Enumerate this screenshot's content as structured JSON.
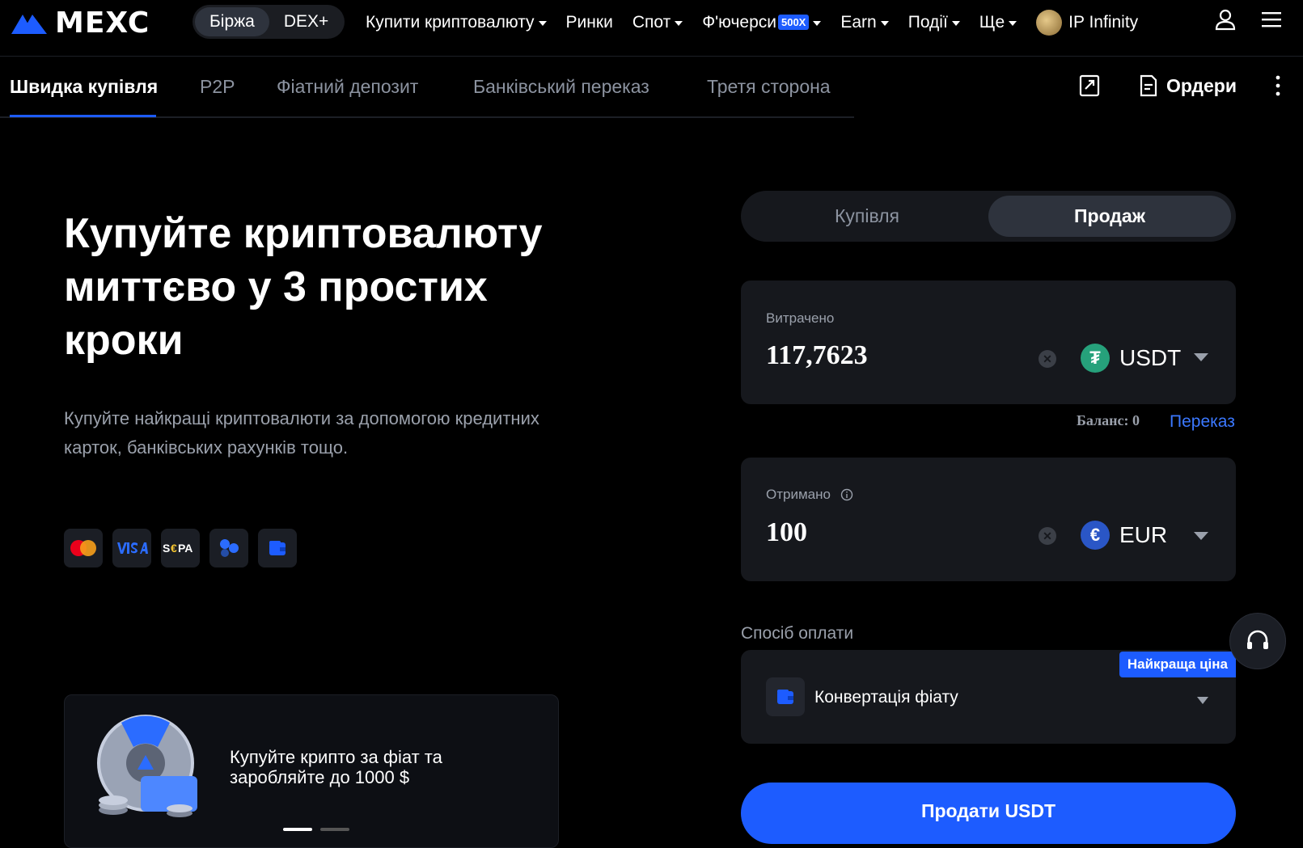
{
  "brand": {
    "name": "MEXC",
    "accent": "#1d5cff"
  },
  "switcher": {
    "exchange": "Біржа",
    "dex": "DEX+"
  },
  "nav": {
    "buy_crypto": "Купити криптовалюту",
    "markets": "Ринки",
    "spot": "Спот",
    "futures": "Ф'ючерси",
    "futures_badge": "500X",
    "earn": "Earn",
    "events": "Події",
    "more": "Ще",
    "ip_infinity": "IP Infinity"
  },
  "tabs": [
    {
      "label": "Швидка купівля"
    },
    {
      "label": "P2P"
    },
    {
      "label": "Фіатний депозит"
    },
    {
      "label": "Банківський переказ"
    },
    {
      "label": "Третя сторона"
    }
  ],
  "subbar": {
    "orders": "Ордери"
  },
  "hero": {
    "title": "Купуйте криптовалюту миттєво у 3 простих кроки",
    "subtitle": "Купуйте найкращі криптовалюти за допомогою кредитних карток, банківських рахунків тощо."
  },
  "payment_icons": [
    "mastercard-icon",
    "visa-icon",
    "sepa-icon",
    "apple-pay-icon",
    "wallet-icon"
  ],
  "promo": {
    "text": "Купуйте крипто за фіат та заробляйте до 1000 $"
  },
  "trade": {
    "buy_label": "Купівля",
    "sell_label": "Продаж",
    "active": "sell"
  },
  "spent": {
    "label": "Витрачено",
    "value": "117,7623",
    "currency": "USDT",
    "currency_color": "#26a17b"
  },
  "balance": {
    "text": "Баланс: 0",
    "transfer": "Переказ"
  },
  "received": {
    "label": "Отримано",
    "value": "100",
    "currency": "EUR",
    "currency_color": "#2a56c6"
  },
  "payment_method": {
    "label": "Спосіб оплати",
    "badge": "Найкраща ціна",
    "selected": "Конвертація фіату"
  },
  "sell_button": "Продати USDT"
}
